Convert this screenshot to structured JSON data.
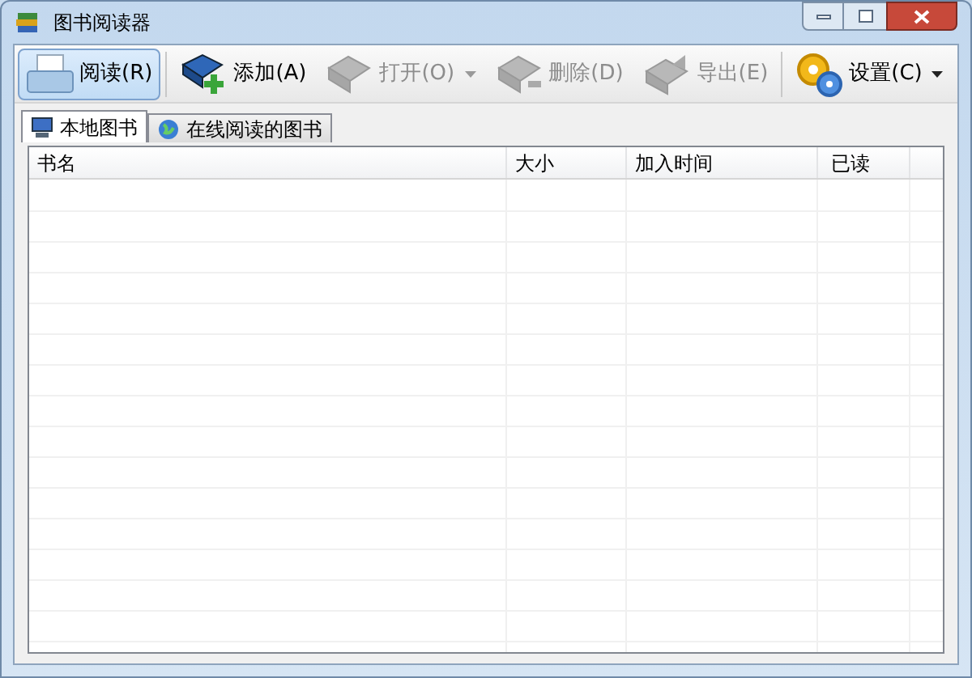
{
  "window": {
    "title": "图书阅读器"
  },
  "toolbar": [
    {
      "label": "阅读(R)",
      "selected": true,
      "disabled": false,
      "has_menu": false
    },
    {
      "label": "添加(A)",
      "selected": false,
      "disabled": false,
      "has_menu": false
    },
    {
      "label": "打开(O)",
      "selected": false,
      "disabled": true,
      "has_menu": true
    },
    {
      "label": "删除(D)",
      "selected": false,
      "disabled": true,
      "has_menu": false
    },
    {
      "label": "导出(E)",
      "selected": false,
      "disabled": true,
      "has_menu": false
    },
    {
      "label": "设置(C)",
      "selected": false,
      "disabled": false,
      "has_menu": true
    }
  ],
  "tabs": [
    {
      "label": "本地图书",
      "selected": true
    },
    {
      "label": "在线阅读的图书",
      "selected": false
    }
  ],
  "table": {
    "columns": [
      "书名",
      "大小",
      "加入时间",
      "已读"
    ]
  }
}
